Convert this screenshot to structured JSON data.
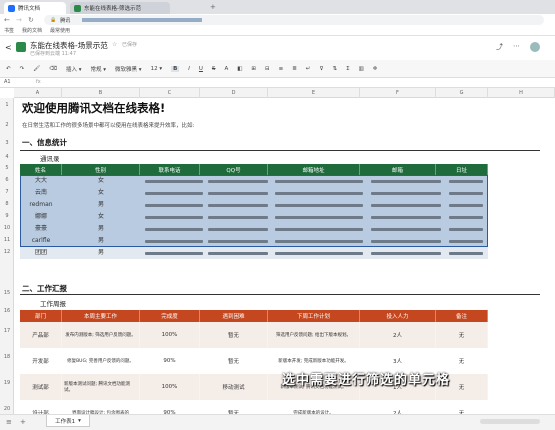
{
  "browser": {
    "tab1_label": "腾讯文档",
    "tab2_label": "东能在线表格-筛选示范",
    "url_label": "腾讯",
    "bookmarks": [
      "书签",
      "我的文档",
      "最常使用"
    ]
  },
  "app": {
    "doc_title": "东能在线表格-场景示范",
    "status": "已保存到云端 11:47",
    "save_state": "已保存"
  },
  "toolbar": {
    "insert": "插入",
    "general": "常规",
    "font": "微软雅黑",
    "size": "12",
    "bold": "B",
    "italic": "I",
    "underline": "U",
    "strike": "S",
    "color_a": "A"
  },
  "formula": {
    "cell_ref": "A1"
  },
  "columns": [
    "A",
    "B",
    "C",
    "D",
    "E",
    "F",
    "G",
    "H"
  ],
  "sheet": {
    "main_title": "欢迎使用腾讯文档在线表格!",
    "intro": "在日常生活和工作的很多场景中都可以使用在线表格来提升效率，比如:",
    "section1": "一、信息统计",
    "table1_caption": "通讯录",
    "table1_headers": [
      "姓名",
      "性别",
      "联系电话",
      "QQ号",
      "邮箱地址",
      "邮箱",
      "日址"
    ],
    "table1_rows": [
      {
        "row": "6",
        "name": "大大",
        "gender": "女"
      },
      {
        "row": "7",
        "name": "云南",
        "gender": "女"
      },
      {
        "row": "8",
        "name": "redman",
        "gender": "男"
      },
      {
        "row": "9",
        "name": "娜娜",
        "gender": "女"
      },
      {
        "row": "10",
        "name": "豪豪",
        "gender": "男"
      },
      {
        "row": "11",
        "name": "carlfle",
        "gender": "男"
      },
      {
        "row": "12",
        "name": "团团",
        "gender": "男"
      }
    ],
    "section2": "二、工作汇报",
    "table2_caption": "工作周报",
    "table2_headers": [
      "部门",
      "本周主要工作",
      "完成度",
      "遇到困难",
      "下周工作计划",
      "投入人力",
      "备注"
    ],
    "table2_rows": [
      {
        "row": "17",
        "dept": "产品部",
        "work": "发布内测版本; 筛选用户反馈问题。",
        "pct": "100%",
        "issue": "暂无",
        "plan": "筛选用户反馈问题; 给出下版本规划。",
        "people": "2人",
        "note": "无"
      },
      {
        "row": "18",
        "dept": "开发部",
        "work": "修复BUG; 完善用户反馈的问题。",
        "pct": "90%",
        "issue": "暂无",
        "plan": "新版本开发; 完成新版本功能开发。",
        "people": "3人",
        "note": "无"
      },
      {
        "row": "19",
        "dept": "测试部",
        "work": "新版本测试问题; 腾讯文档功能测试。",
        "pct": "100%",
        "issue": "移动测试",
        "plan": "新版本测试; 腾讯文档功能测试。",
        "people": "1人",
        "note": "无"
      },
      {
        "row": "20",
        "dept": "设计部",
        "work": "界面设计稿设计; 包含图表的",
        "pct": "90%",
        "issue": "暂无",
        "plan": "完成新版本的设计。",
        "people": "2人",
        "note": "无"
      }
    ]
  },
  "sheet_tab": "工作表1",
  "caption": "选中需要进行筛选的单元格",
  "colors": {
    "green": "#1f6b3c",
    "orange": "#c4471f",
    "selection": "#b7c9dd",
    "blue": "#1e6fff"
  }
}
